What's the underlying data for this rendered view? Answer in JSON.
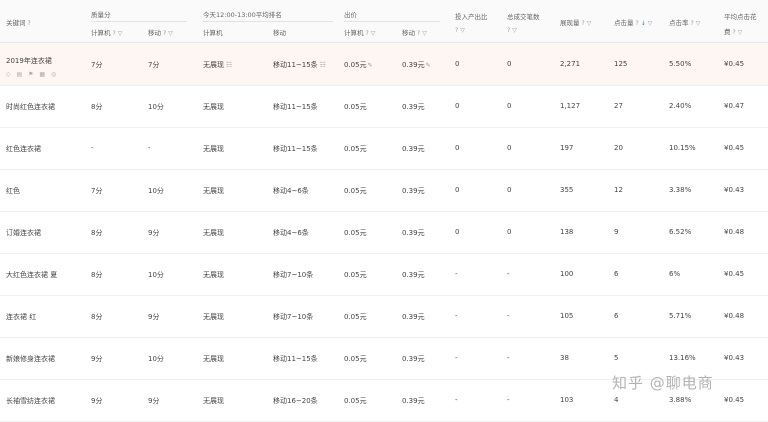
{
  "headers": {
    "keyword": "关键词",
    "quality_group": "质量分",
    "quality_pc": "计算机",
    "quality_mobile": "移动",
    "rank_group": "今天12:00-13:00平均排名",
    "rank_pc": "计算机",
    "rank_mobile": "移动",
    "bid_group": "出价",
    "bid_pc": "计算机",
    "bid_mobile": "移动",
    "roi": "投入产出比",
    "deals": "总成交笔数",
    "impressions": "展现量",
    "clicks": "点击量",
    "ctr": "点击率",
    "avg_cpc_line1": "平均点击花",
    "avg_cpc_line2": "费"
  },
  "rows": [
    {
      "keyword": "2019年连衣裙",
      "q_pc": "7分",
      "q_mobile": "7分",
      "rank_pc": "无展现",
      "rank_mobile": "移动11~15条",
      "bid_pc": "0.05元",
      "bid_mobile": "0.39元",
      "roi": "0",
      "deals": "0",
      "impressions": "2,271",
      "clicks": "125",
      "ctr": "5.50%",
      "cpc": "¥0.45"
    },
    {
      "keyword": "时尚红色连衣裙",
      "q_pc": "8分",
      "q_mobile": "10分",
      "rank_pc": "无展现",
      "rank_mobile": "移动11~15条",
      "bid_pc": "0.05元",
      "bid_mobile": "0.39元",
      "roi": "0",
      "deals": "0",
      "impressions": "1,127",
      "clicks": "27",
      "ctr": "2.40%",
      "cpc": "¥0.47"
    },
    {
      "keyword": "红色连衣裙",
      "q_pc": "-",
      "q_mobile": "-",
      "rank_pc": "无展现",
      "rank_mobile": "移动11~15条",
      "bid_pc": "0.05元",
      "bid_mobile": "0.39元",
      "roi": "0",
      "deals": "0",
      "impressions": "197",
      "clicks": "20",
      "ctr": "10.15%",
      "cpc": "¥0.45"
    },
    {
      "keyword": "红色",
      "q_pc": "7分",
      "q_mobile": "10分",
      "rank_pc": "无展现",
      "rank_mobile": "移动4~6条",
      "bid_pc": "0.05元",
      "bid_mobile": "0.39元",
      "roi": "0",
      "deals": "0",
      "impressions": "355",
      "clicks": "12",
      "ctr": "3.38%",
      "cpc": "¥0.43"
    },
    {
      "keyword": "订婚连衣裙",
      "q_pc": "8分",
      "q_mobile": "9分",
      "rank_pc": "无展现",
      "rank_mobile": "移动4~6条",
      "bid_pc": "0.05元",
      "bid_mobile": "0.39元",
      "roi": "0",
      "deals": "0",
      "impressions": "138",
      "clicks": "9",
      "ctr": "6.52%",
      "cpc": "¥0.48"
    },
    {
      "keyword": "大红色连衣裙 夏",
      "q_pc": "8分",
      "q_mobile": "10分",
      "rank_pc": "无展现",
      "rank_mobile": "移动7~10条",
      "bid_pc": "0.05元",
      "bid_mobile": "0.39元",
      "roi": "-",
      "deals": "-",
      "impressions": "100",
      "clicks": "6",
      "ctr": "6%",
      "cpc": "¥0.45"
    },
    {
      "keyword": "连衣裙 红",
      "q_pc": "8分",
      "q_mobile": "9分",
      "rank_pc": "无展现",
      "rank_mobile": "移动7~10条",
      "bid_pc": "0.05元",
      "bid_mobile": "0.39元",
      "roi": "-",
      "deals": "-",
      "impressions": "105",
      "clicks": "6",
      "ctr": "5.71%",
      "cpc": "¥0.48"
    },
    {
      "keyword": "新娘修身连衣裙",
      "q_pc": "9分",
      "q_mobile": "10分",
      "rank_pc": "无展现",
      "rank_mobile": "移动11~15条",
      "bid_pc": "0.05元",
      "bid_mobile": "0.39元",
      "roi": "-",
      "deals": "-",
      "impressions": "38",
      "clicks": "5",
      "ctr": "13.16%",
      "cpc": "¥0.43"
    },
    {
      "keyword": "长袖雪纺连衣裙",
      "q_pc": "9分",
      "q_mobile": "9分",
      "rank_pc": "无展现",
      "rank_mobile": "移动16~20条",
      "bid_pc": "0.05元",
      "bid_mobile": "0.39元",
      "roi": "-",
      "deals": "-",
      "impressions": "103",
      "clicks": "4",
      "ctr": "3.88%",
      "cpc": "¥0.45"
    }
  ],
  "watermark": "知乎 @聊电商"
}
